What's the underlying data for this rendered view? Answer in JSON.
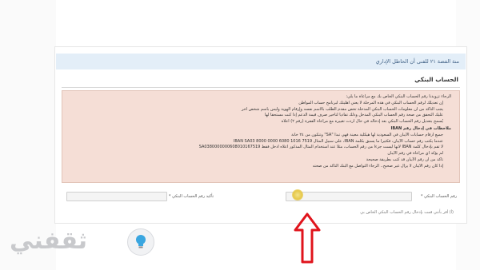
{
  "notice_bar": {
    "text": "منة الفضة ٢١ للفنى أن الحاطل الإداري"
  },
  "section_title": "الحساب البنكي",
  "info": {
    "intro": "الرجاء تزويدنا رقم الحساب البنكي الخاص بك مع مراعاة ما يلي:",
    "rules": [
      "إن تعديلك لرقم الحساب البنكي في هذه المرحلة لا يعني أهليتك لبرنامج حساب المواطن",
      "يجب التأكد من أن معلومات الحساب البنكي المدخلة تخص مقدم الطلب بالاسم نفسه وإرقام الهوية وليس باسم شخص آخر",
      "عليك التحقق من صحة رقم الحساب البنكي المدخل وذلك تفاديا لتأخير صرف قيمة الدعم إذا كنت مستحقا لها",
      "يُسمح بتعديل رقم الحساب البنكي بعد إدخاله في حال أردت تغييره مع مراعاة الفقرة (رقم ٢) أعلاه"
    ],
    "notes_title": "ملاحظات في إدخال رقم IBAN",
    "notes": [
      "جميع أرقام حسابات الآيبان في السعودية لها هيكلية معينة فهي تبدأ \"SA\" وتتكون من ٢٤ خانة",
      "عندما يكتب رقم حساب الآيبان، فكثيرا ما يسبق بكلمة IBAN، على سبيل المثال IBAN SA03 8000 0000 6080 1016 7519",
      "لا تقم بإدخال كلمة IBAN لأنها ليست جزءا من رقم الحساب، مثلا عند استخدام المثال المذكور أعلاه أدخل فقط SA0380000000608010167519",
      "لم يؤكد أي مراعاة في رقم الآيبان",
      "تأكد من أن رقم الآيبان قد كتب بطريقة صحيحة",
      "إذا كان رقم الآيبان لا يزال غير صحيح.. الرجاء التواصل مع البنك التأكد من صحته"
    ]
  },
  "form": {
    "iban_label": "رقم الحساب البنكي *",
    "iban_value": "",
    "confirm_label": "تأكيد رقم الحساب البنكي *",
    "confirm_value": ""
  },
  "footnote": "(أ) أقر بأنني قمت بإدخال رقم الحساب البنكي الخاص بي",
  "branding": {
    "logo_text": "ثقفني",
    "logo_color": "#c8c9cc"
  },
  "colors": {
    "notice_bg": "#e3eef8",
    "info_bg": "#f5ded6",
    "arrow": "#e0141c"
  }
}
